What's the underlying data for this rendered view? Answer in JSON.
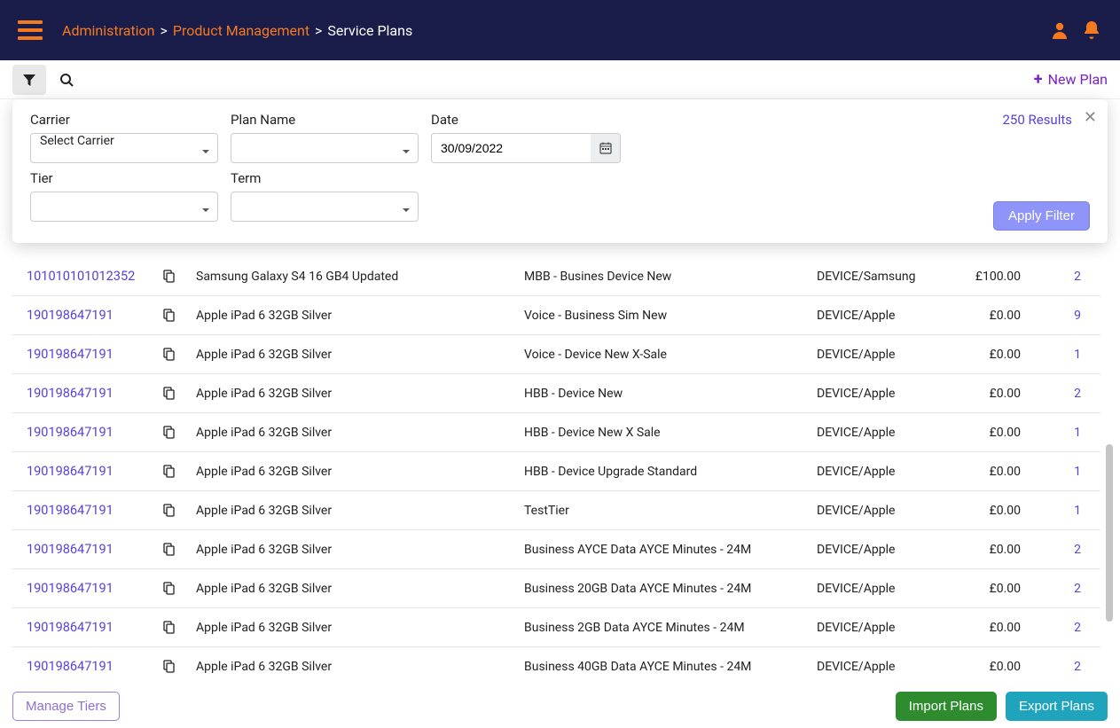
{
  "breadcrumb": {
    "items": [
      "Administration",
      "Product Management"
    ],
    "current": "Service Plans",
    "sep": ">"
  },
  "toolbar": {
    "new_plan": "New Plan"
  },
  "filter": {
    "labels": {
      "carrier": "Carrier",
      "plan_name": "Plan Name",
      "date": "Date",
      "tier": "Tier",
      "term": "Term"
    },
    "carrier_placeholder": "Select Carrier",
    "date_value": "30/09/2022",
    "results": "250 Results",
    "apply": "Apply Filter"
  },
  "rows": [
    {
      "id": "101010101012352",
      "name": "Samsung Galaxy S4 16 GB4 Updated",
      "tier": "MBB - Busines Device New",
      "cat": "DEVICE/Samsung",
      "price": "£100.00",
      "count": "2"
    },
    {
      "id": "190198647191",
      "name": "Apple iPad 6 32GB Silver",
      "tier": "Voice - Business Sim New",
      "cat": "DEVICE/Apple",
      "price": "£0.00",
      "count": "9"
    },
    {
      "id": "190198647191",
      "name": "Apple iPad 6 32GB Silver",
      "tier": "Voice - Device New X-Sale",
      "cat": "DEVICE/Apple",
      "price": "£0.00",
      "count": "1"
    },
    {
      "id": "190198647191",
      "name": "Apple iPad 6 32GB Silver",
      "tier": "HBB - Device New",
      "cat": "DEVICE/Apple",
      "price": "£0.00",
      "count": "2"
    },
    {
      "id": "190198647191",
      "name": "Apple iPad 6 32GB Silver",
      "tier": "HBB - Device New X Sale",
      "cat": "DEVICE/Apple",
      "price": "£0.00",
      "count": "1"
    },
    {
      "id": "190198647191",
      "name": "Apple iPad 6 32GB Silver",
      "tier": "HBB - Device Upgrade Standard",
      "cat": "DEVICE/Apple",
      "price": "£0.00",
      "count": "1"
    },
    {
      "id": "190198647191",
      "name": "Apple iPad 6 32GB Silver",
      "tier": "TestTier",
      "cat": "DEVICE/Apple",
      "price": "£0.00",
      "count": "1"
    },
    {
      "id": "190198647191",
      "name": "Apple iPad 6 32GB Silver",
      "tier": "Business AYCE Data AYCE Minutes - 24M",
      "cat": "DEVICE/Apple",
      "price": "£0.00",
      "count": "2"
    },
    {
      "id": "190198647191",
      "name": "Apple iPad 6 32GB Silver",
      "tier": "Business 20GB Data AYCE Minutes - 24M",
      "cat": "DEVICE/Apple",
      "price": "£0.00",
      "count": "2"
    },
    {
      "id": "190198647191",
      "name": "Apple iPad 6 32GB Silver",
      "tier": "Business 2GB Data AYCE Minutes - 24M",
      "cat": "DEVICE/Apple",
      "price": "£0.00",
      "count": "2"
    },
    {
      "id": "190198647191",
      "name": "Apple iPad 6 32GB Silver",
      "tier": "Business 40GB Data AYCE Minutes - 24M",
      "cat": "DEVICE/Apple",
      "price": "£0.00",
      "count": "2"
    }
  ],
  "footer": {
    "manage_tiers": "Manage Tiers",
    "import": "Import Plans",
    "export": "Export Plans"
  }
}
